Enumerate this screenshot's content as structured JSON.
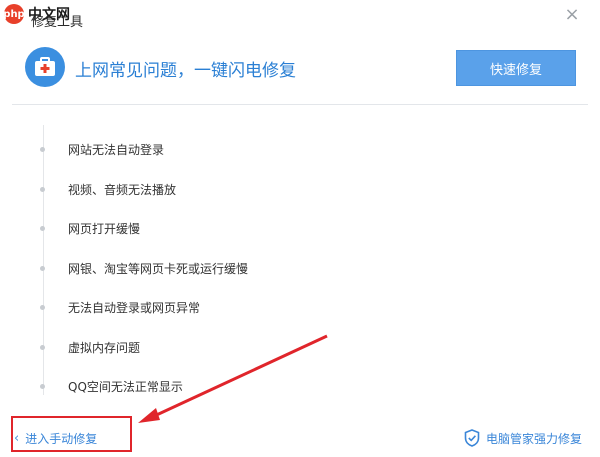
{
  "logo": {
    "mark": "php",
    "text": "中文网"
  },
  "window": {
    "title": "修复工具",
    "close_glyph": "×"
  },
  "header": {
    "icon": "medical-kit-icon",
    "title": "上网常见问题，一键闪电修复",
    "quick_fix_label": "快速修复"
  },
  "issues": [
    "网站无法自动登录",
    "视频、音频无法播放",
    "网页打开缓慢",
    "网银、淘宝等网页卡死或运行缓慢",
    "无法自动登录或网页异常",
    "虚拟内存问题",
    "QQ空间无法正常显示"
  ],
  "footer": {
    "manual_link": "进入手动修复",
    "manual_chevron": "‹",
    "manager_link": "电脑管家强力修复"
  },
  "colors": {
    "accent": "#2a7fd4",
    "button": "#5aa1ea",
    "annotation": "#e0252b"
  }
}
